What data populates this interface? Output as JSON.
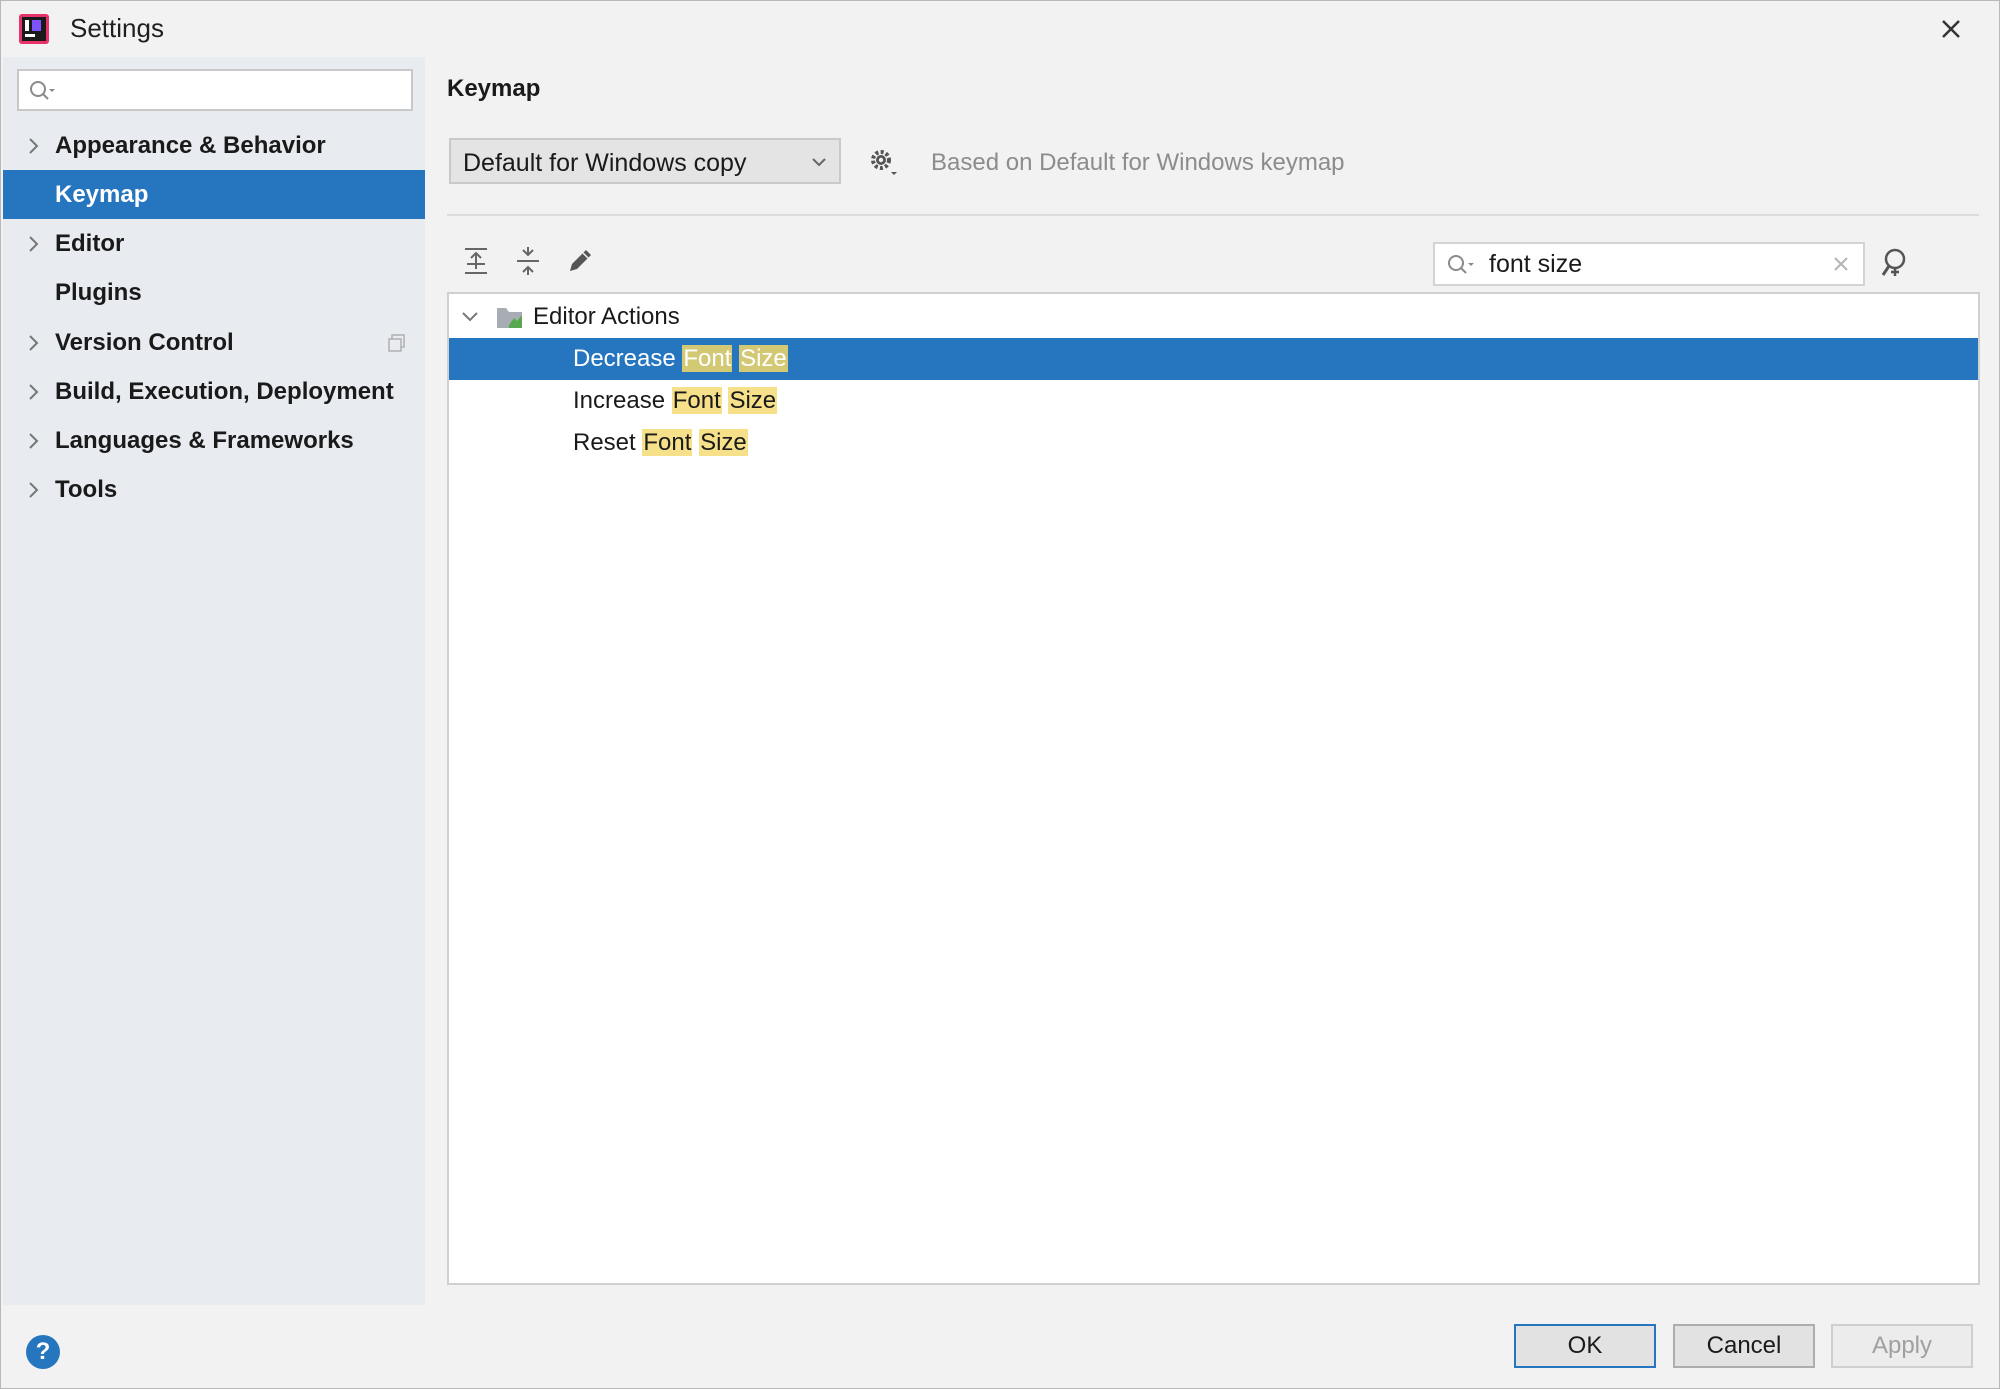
{
  "window": {
    "title": "Settings"
  },
  "sidebar": {
    "search": {
      "value": "",
      "placeholder": ""
    },
    "items": [
      {
        "label": "Appearance & Behavior",
        "expandable": true
      },
      {
        "label": "Keymap",
        "expandable": false,
        "selected": true
      },
      {
        "label": "Editor",
        "expandable": true
      },
      {
        "label": "Plugins",
        "expandable": false
      },
      {
        "label": "Version Control",
        "expandable": true
      },
      {
        "label": "Build, Execution, Deployment",
        "expandable": true
      },
      {
        "label": "Languages & Frameworks",
        "expandable": true
      },
      {
        "label": "Tools",
        "expandable": true
      }
    ]
  },
  "main": {
    "title": "Keymap",
    "keymap_select": {
      "value": "Default for Windows copy"
    },
    "based_on": "Based on Default for Windows keymap",
    "filter": {
      "value": "font size"
    },
    "tree": {
      "group": "Editor Actions",
      "actions": [
        {
          "prefix": "Decrease",
          "hl1": "Font",
          "hl2": "Size",
          "selected": true
        },
        {
          "prefix": "Increase",
          "hl1": "Font",
          "hl2": "Size",
          "selected": false
        },
        {
          "prefix": "Reset",
          "hl1": "Font",
          "hl2": "Size",
          "selected": false
        }
      ]
    }
  },
  "footer": {
    "help": "?",
    "ok": "OK",
    "cancel": "Cancel",
    "apply": "Apply"
  },
  "colors": {
    "selection": "#2675bf",
    "highlight": "#f7e08a",
    "sidebar_bg": "#e8ebf0"
  }
}
